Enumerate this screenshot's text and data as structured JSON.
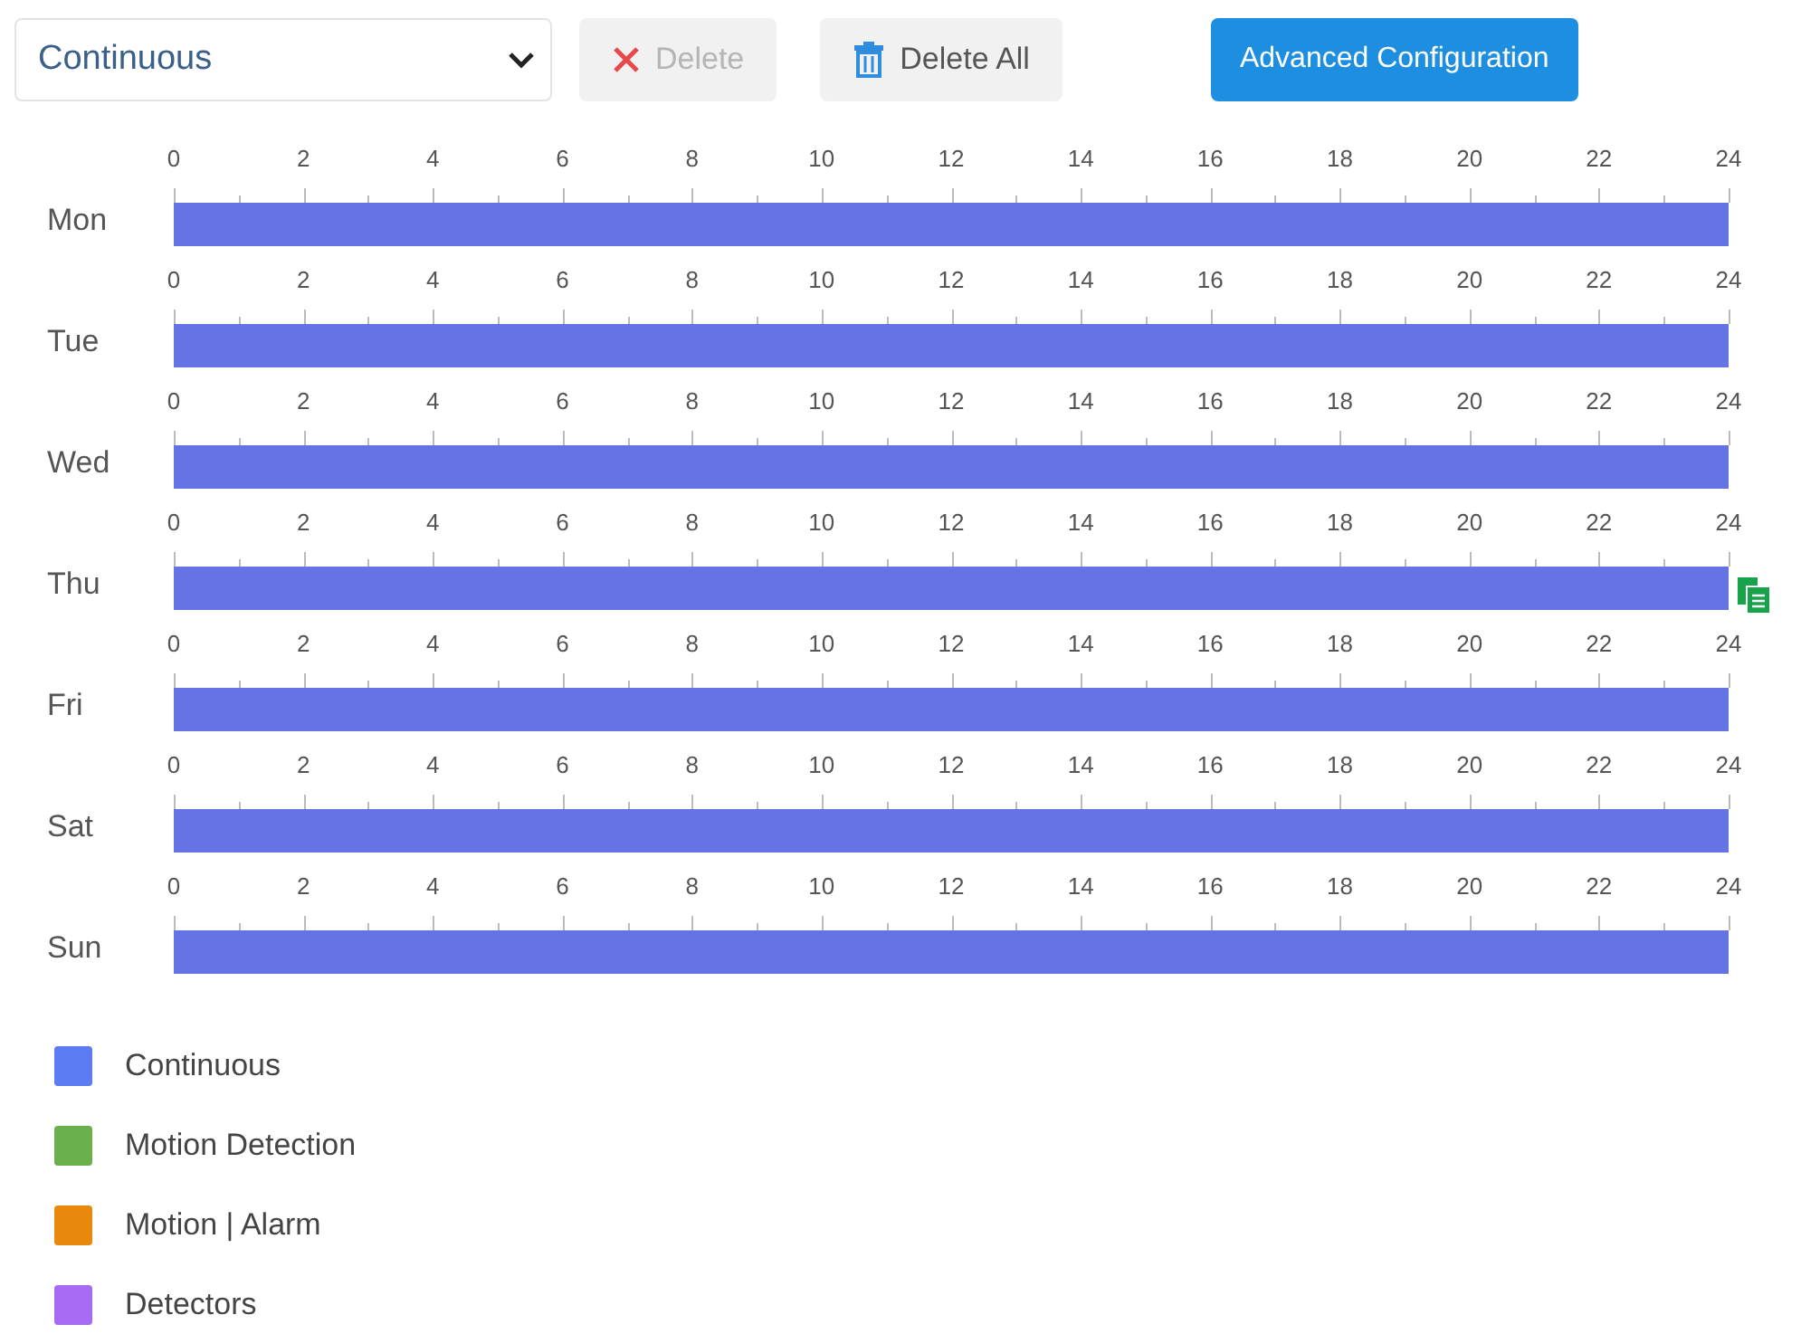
{
  "toolbar": {
    "mode_select": {
      "value": "Continuous"
    },
    "buttons": [
      {
        "kind": "delete",
        "label": "Delete",
        "disabled": true
      },
      {
        "kind": "delete_all",
        "label": "Delete All",
        "disabled": false
      },
      {
        "kind": "primary",
        "label": "Advanced Configuration",
        "disabled": false
      }
    ]
  },
  "days": [
    {
      "label": "Mon",
      "ticks": [
        "0",
        "2",
        "4",
        "6",
        "8",
        "10",
        "12",
        "14",
        "16",
        "18",
        "20",
        "22",
        "24"
      ],
      "level": 1,
      "color": "#6474e5",
      "copy_icon": false
    },
    {
      "label": "Tue",
      "ticks": [
        "0",
        "2",
        "4",
        "6",
        "8",
        "10",
        "12",
        "14",
        "16",
        "18",
        "20",
        "22",
        "24"
      ],
      "level": 1,
      "color": "#6474e5",
      "copy_icon": false
    },
    {
      "label": "Wed",
      "ticks": [
        "0",
        "2",
        "4",
        "6",
        "8",
        "10",
        "12",
        "14",
        "16",
        "18",
        "20",
        "22",
        "24"
      ],
      "level": 1,
      "color": "#6474e5",
      "copy_icon": false
    },
    {
      "label": "Thu",
      "ticks": [
        "0",
        "2",
        "4",
        "6",
        "8",
        "10",
        "12",
        "14",
        "16",
        "18",
        "20",
        "22",
        "24"
      ],
      "level": 1,
      "color": "#6474e5",
      "copy_icon": true
    },
    {
      "label": "Fri",
      "ticks": [
        "0",
        "2",
        "4",
        "6",
        "8",
        "10",
        "12",
        "14",
        "16",
        "18",
        "20",
        "22",
        "24"
      ],
      "level": 1,
      "color": "#6474e5",
      "copy_icon": false
    },
    {
      "label": "Sat",
      "ticks": [
        "0",
        "2",
        "4",
        "6",
        "8",
        "10",
        "12",
        "14",
        "16",
        "18",
        "20",
        "22",
        "24"
      ],
      "level": 1,
      "color": "#6474e5",
      "copy_icon": false
    },
    {
      "label": "Sun",
      "ticks": [
        "0",
        "2",
        "4",
        "6",
        "8",
        "10",
        "12",
        "14",
        "16",
        "18",
        "20",
        "22",
        "24"
      ],
      "level": 1,
      "color": "#6474e5",
      "copy_icon": false
    }
  ],
  "legend": [
    {
      "label": "Continuous",
      "color": "#5b7cf2"
    },
    {
      "label": "Motion Detection",
      "color": "#6ab04c"
    },
    {
      "label": "Motion | Alarm",
      "color": "#e8890c"
    },
    {
      "label": "Detectors",
      "color": "#a66bf2"
    }
  ]
}
